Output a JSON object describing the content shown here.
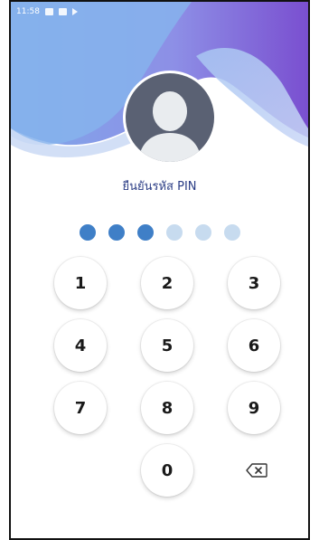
{
  "status_bar": {
    "time": "11:58"
  },
  "title": "ยืนยันรหัส PIN",
  "pin": {
    "length": 6,
    "entered": 3
  },
  "keypad": {
    "keys": [
      "1",
      "2",
      "3",
      "4",
      "5",
      "6",
      "7",
      "8",
      "9",
      "0"
    ],
    "backspace_icon": "backspace-icon"
  },
  "colors": {
    "title": "#2b3d85",
    "dot_filled": "#3f7fc7",
    "dot_empty": "#c7dbef",
    "wave_light": "#8fb6ee",
    "wave_dark": "#8656d6",
    "avatar_bg": "#5a6173"
  }
}
